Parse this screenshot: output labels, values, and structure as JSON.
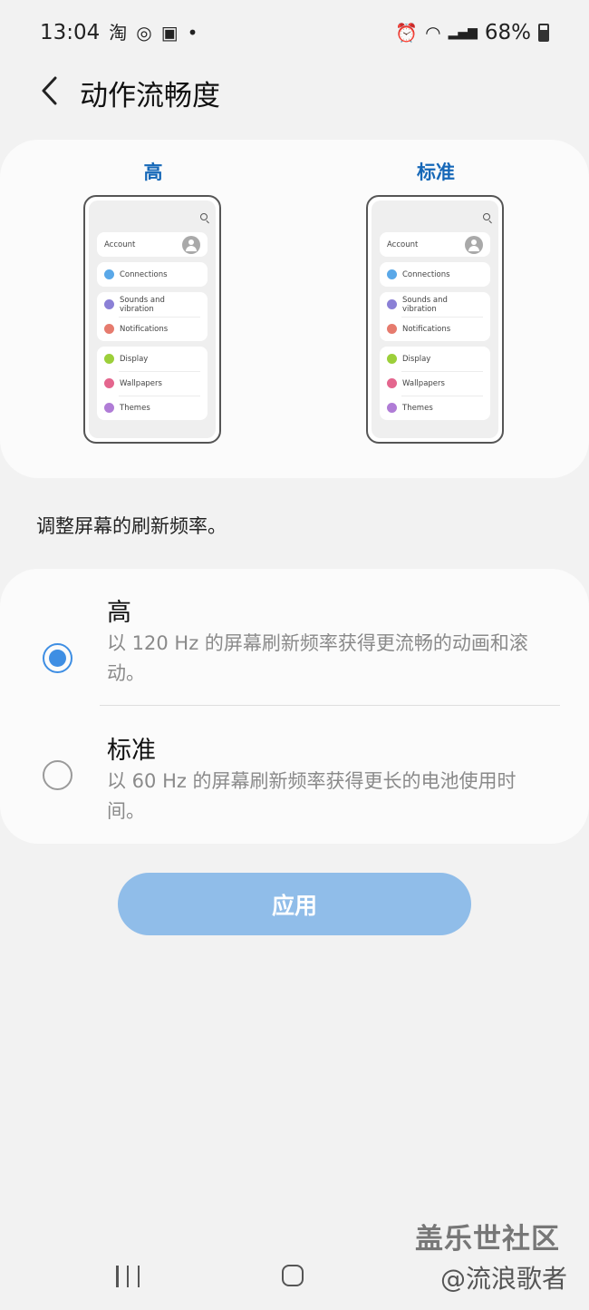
{
  "status_bar": {
    "time": "13:04",
    "left_icons": [
      "taobao-icon",
      "weibo-icon",
      "gallery-icon",
      "dot-icon"
    ],
    "taobao_glyph": "淘",
    "weibo_glyph": "◎",
    "gallery_glyph": "▣",
    "dot_glyph": "•",
    "alarm_glyph": "⏰",
    "wifi_glyph": "◠",
    "signal_glyph": "▂▄▆",
    "battery_percent": "68%"
  },
  "header": {
    "title": "动作流畅度"
  },
  "preview": {
    "high_label": "高",
    "standard_label": "标准",
    "screen_items": {
      "account": "Account",
      "connections": "Connections",
      "sounds": "Sounds and vibration",
      "notifications": "Notifications",
      "display": "Display",
      "wallpapers": "Wallpapers",
      "themes": "Themes"
    },
    "icon_colors": {
      "connections": "#5aa8e8",
      "sounds": "#8b80d6",
      "notifications": "#e67b6e",
      "display": "#9ccf3a",
      "wallpapers": "#e4668e",
      "themes": "#b07cd6"
    }
  },
  "description": "调整屏幕的刷新频率。",
  "options": [
    {
      "title": "高",
      "description": "以 120 Hz 的屏幕刷新频率获得更流畅的动画和滚动。",
      "selected": true
    },
    {
      "title": "标准",
      "description": "以 60 Hz 的屏幕刷新频率获得更长的电池使用时间。",
      "selected": false
    }
  ],
  "apply_button": "应用",
  "watermark": {
    "line1": "盖乐世社区",
    "line2": "@流浪歌者"
  },
  "colors": {
    "accent": "#3e8ee3",
    "apply_button_bg": "#90bde9",
    "preview_label": "#1668b8"
  }
}
